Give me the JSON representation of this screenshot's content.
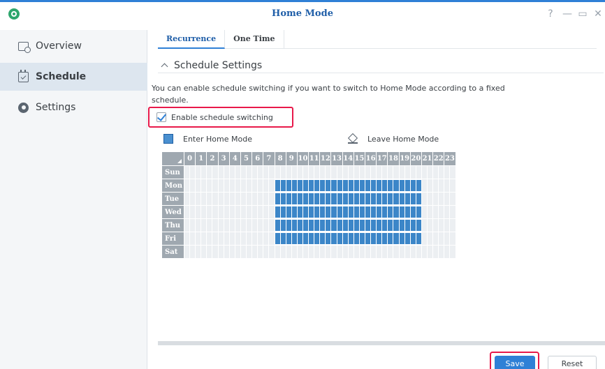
{
  "window": {
    "title": "Home Mode",
    "help": "?",
    "minimize": "—",
    "maximize": "▭",
    "close": "✕"
  },
  "sidebar": {
    "items": [
      {
        "label": "Overview",
        "icon": "overview-icon",
        "active": false
      },
      {
        "label": "Schedule",
        "icon": "calendar-icon",
        "active": true
      },
      {
        "label": "Settings",
        "icon": "gear-icon",
        "active": false
      }
    ]
  },
  "tabs": [
    {
      "label": "Recurrence",
      "active": true
    },
    {
      "label": "One Time",
      "active": false
    }
  ],
  "section": {
    "title": "Schedule Settings"
  },
  "description": "You can enable schedule switching if you want to switch to Home Mode according to a fixed schedule.",
  "enable": {
    "label": "Enable schedule switching",
    "checked": true
  },
  "legend": {
    "enter": "Enter Home Mode",
    "leave": "Leave Home Mode"
  },
  "schedule": {
    "hours": [
      "0",
      "1",
      "2",
      "3",
      "4",
      "5",
      "6",
      "7",
      "8",
      "9",
      "10",
      "11",
      "12",
      "13",
      "14",
      "15",
      "16",
      "17",
      "18",
      "19",
      "20",
      "21",
      "22",
      "23"
    ],
    "days": [
      "Sun",
      "Mon",
      "Tue",
      "Wed",
      "Thu",
      "Fri",
      "Sat"
    ],
    "active_days": [
      "Mon",
      "Tue",
      "Wed",
      "Thu",
      "Fri"
    ],
    "active_start_hour": 8,
    "active_end_hour": 21,
    "cells_per_hour": 2
  },
  "buttons": {
    "save": "Save",
    "reset": "Reset"
  },
  "colors": {
    "accent": "#2f80d6",
    "highlight": "#e8194a",
    "active_cell": "#3c86c8",
    "header_gray": "#9fa8b0"
  }
}
